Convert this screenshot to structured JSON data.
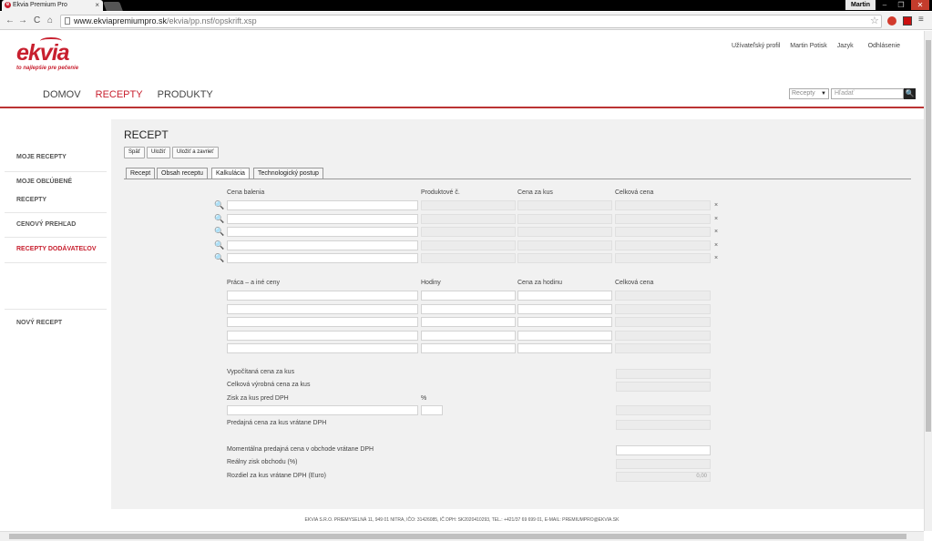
{
  "browser": {
    "tab_title": "Ekvia Premium Pro",
    "tab_close": "×",
    "favicon_letter": "e",
    "user": "Martin",
    "url_domain": "www.ekviapremiumpro.sk",
    "url_path": "/ekvia/pp.nsf/opskrift.xsp",
    "minimize": "–",
    "restore": "❐",
    "close": "✕",
    "back": "←",
    "forward": "→",
    "reload": "C",
    "home": "⌂",
    "star": "☆",
    "menu": "≡"
  },
  "header": {
    "logo": "ekvia",
    "tagline": "to najlepšie pre pečenie",
    "links": [
      "Užívateľský profil",
      "Martin Potisk",
      "Jazyk",
      "Odhlásenie"
    ],
    "nav": [
      "DOMOV",
      "RECEPTY",
      "PRODUKTY"
    ],
    "active_nav": "RECEPTY",
    "search_select": "Recepty",
    "search_select_arrow": "▼",
    "search_placeholder": "Hľadať",
    "search_icon": "🔍"
  },
  "sidebar": {
    "items": [
      "MOJE RECEPTY",
      "MOJE OBĽÚBENÉ",
      "RECEPTY",
      "CENOVÝ PREHĽAD",
      "RECEPTY DODÁVATEĽOV",
      "NOVÝ RECEPT"
    ]
  },
  "content": {
    "title": "RECEPT",
    "buttons": [
      "Späť",
      "Uložiť",
      "Uložiť a zavrieť"
    ],
    "tabs": [
      "Recept",
      "Obsah receptu",
      "Kalkulácia",
      "Technologický postup"
    ],
    "active_tab": "Kalkulácia",
    "ingredients": {
      "headers": [
        "Cena balenia",
        "Produktové č.",
        "Cena za kus",
        "Celková cena"
      ],
      "row_count": 5,
      "magnifier": "🔍",
      "delete": "×"
    },
    "labor": {
      "headers": [
        "Práca – a iné ceny",
        "Hodiny",
        "Cena za hodinu",
        "Celková cena"
      ],
      "row_count": 5
    },
    "summary": {
      "calc_price": "Vypočítaná cena za kus",
      "total_prod": "Celková výrobná cena za kus",
      "profit": "Zisk za kus pred DPH",
      "percent": "%",
      "sale_price": "Predajná cena za kus vrátane DPH",
      "current_price": "Momentálna predajná cena v obchode vrátane DPH",
      "real_profit": "Reálny zisk obchodu (%)",
      "diff": "Rozdiel za kus vrátane DPH (Euro)",
      "diff_value": "0,00"
    }
  },
  "footer": {
    "text": "EKVIA S.R.O. PRIEMYSELNÁ 11, 949 01 NITRA, IČO: 31426085, IČ DPH: SK2020410293, TEL.: +421/37 69 699 01, E-MAIL: PREMIUMPRO@EKVIA.SK"
  }
}
